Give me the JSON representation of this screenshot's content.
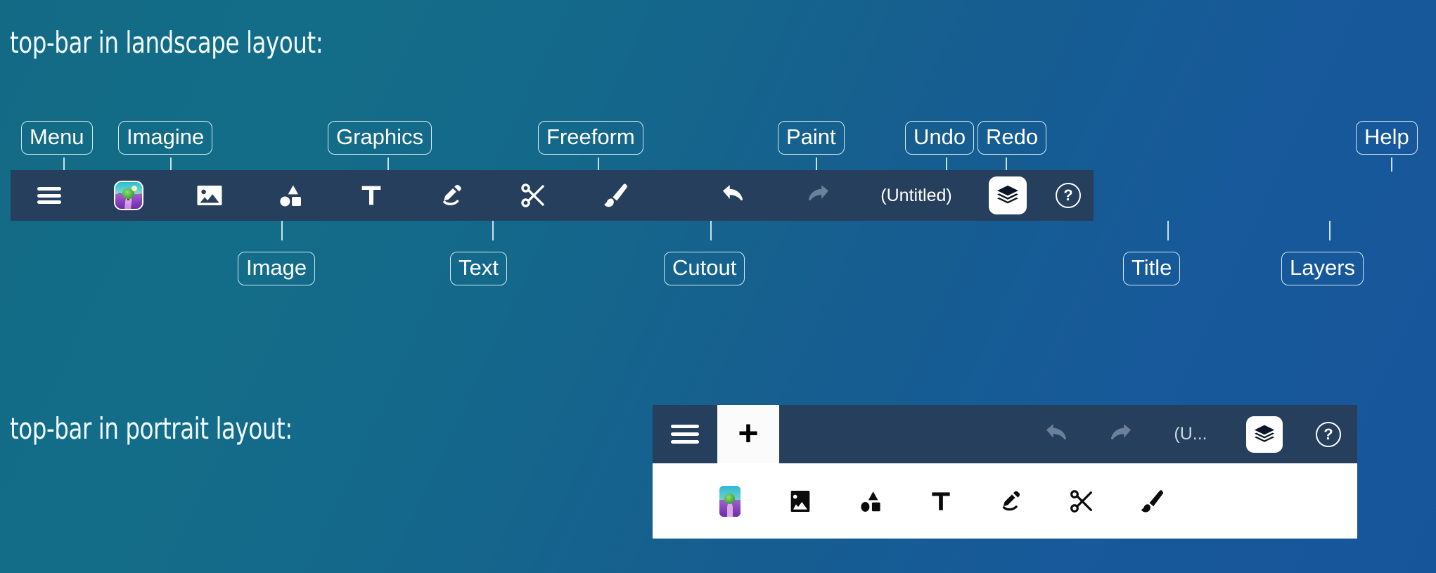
{
  "headings": {
    "landscape": "top-bar in landscape layout:",
    "portrait": "top-bar in portrait layout:"
  },
  "callouts_above": [
    {
      "label": "Menu"
    },
    {
      "label": "Imagine"
    },
    {
      "label": "Graphics"
    },
    {
      "label": "Freeform"
    },
    {
      "label": "Paint"
    },
    {
      "label": "Undo"
    },
    {
      "label": "Redo"
    },
    {
      "label": "Help"
    }
  ],
  "callouts_below": [
    {
      "label": "Image"
    },
    {
      "label": "Text"
    },
    {
      "label": "Cutout"
    },
    {
      "label": "Title"
    },
    {
      "label": "Layers"
    }
  ],
  "landscape_toolbar": {
    "menu_icon": "hamburger-menu-icon",
    "imagine_icon": "imagine-thumbnail-icon",
    "image_icon": "image-picture-icon",
    "graphics_icon": "shapes-graphics-icon",
    "text_icon": "text-tool-icon",
    "freeform_icon": "pen-freeform-icon",
    "cutout_icon": "scissors-cutout-icon",
    "paint_icon": "paint-brush-icon",
    "undo_icon": "undo-arrow-icon",
    "redo_icon": "redo-arrow-icon",
    "undo_state": "enabled",
    "redo_state": "disabled",
    "title": "(Untitled)",
    "layers_icon": "layers-stack-icon",
    "help_icon": "help-question-icon",
    "help_label": "?"
  },
  "portrait_toolbar": {
    "menu_icon": "hamburger-menu-icon",
    "add_label": "+",
    "add_icon": "plus-add-icon",
    "undo_icon": "undo-arrow-icon",
    "redo_icon": "redo-arrow-icon",
    "undo_state": "disabled",
    "redo_state": "disabled",
    "title": "(U...",
    "layers_icon": "layers-stack-icon",
    "help_icon": "help-question-icon",
    "help_label": "?",
    "tools": [
      {
        "name": "imagine",
        "icon": "imagine-thumbnail-icon"
      },
      {
        "name": "image",
        "icon": "image-picture-icon"
      },
      {
        "name": "graphics",
        "icon": "shapes-graphics-icon"
      },
      {
        "name": "text",
        "icon": "text-tool-icon"
      },
      {
        "name": "freeform",
        "icon": "pen-freeform-icon"
      },
      {
        "name": "cutout",
        "icon": "scissors-cutout-icon"
      },
      {
        "name": "paint",
        "icon": "paint-brush-icon"
      }
    ]
  },
  "colors": {
    "background_teal": "#136a85",
    "background_blue": "#17559b",
    "toolbar_navy": "#263f5c",
    "icon_white": "#ffffff",
    "icon_disabled": "#6d8099",
    "panel_white": "#ffffff"
  }
}
